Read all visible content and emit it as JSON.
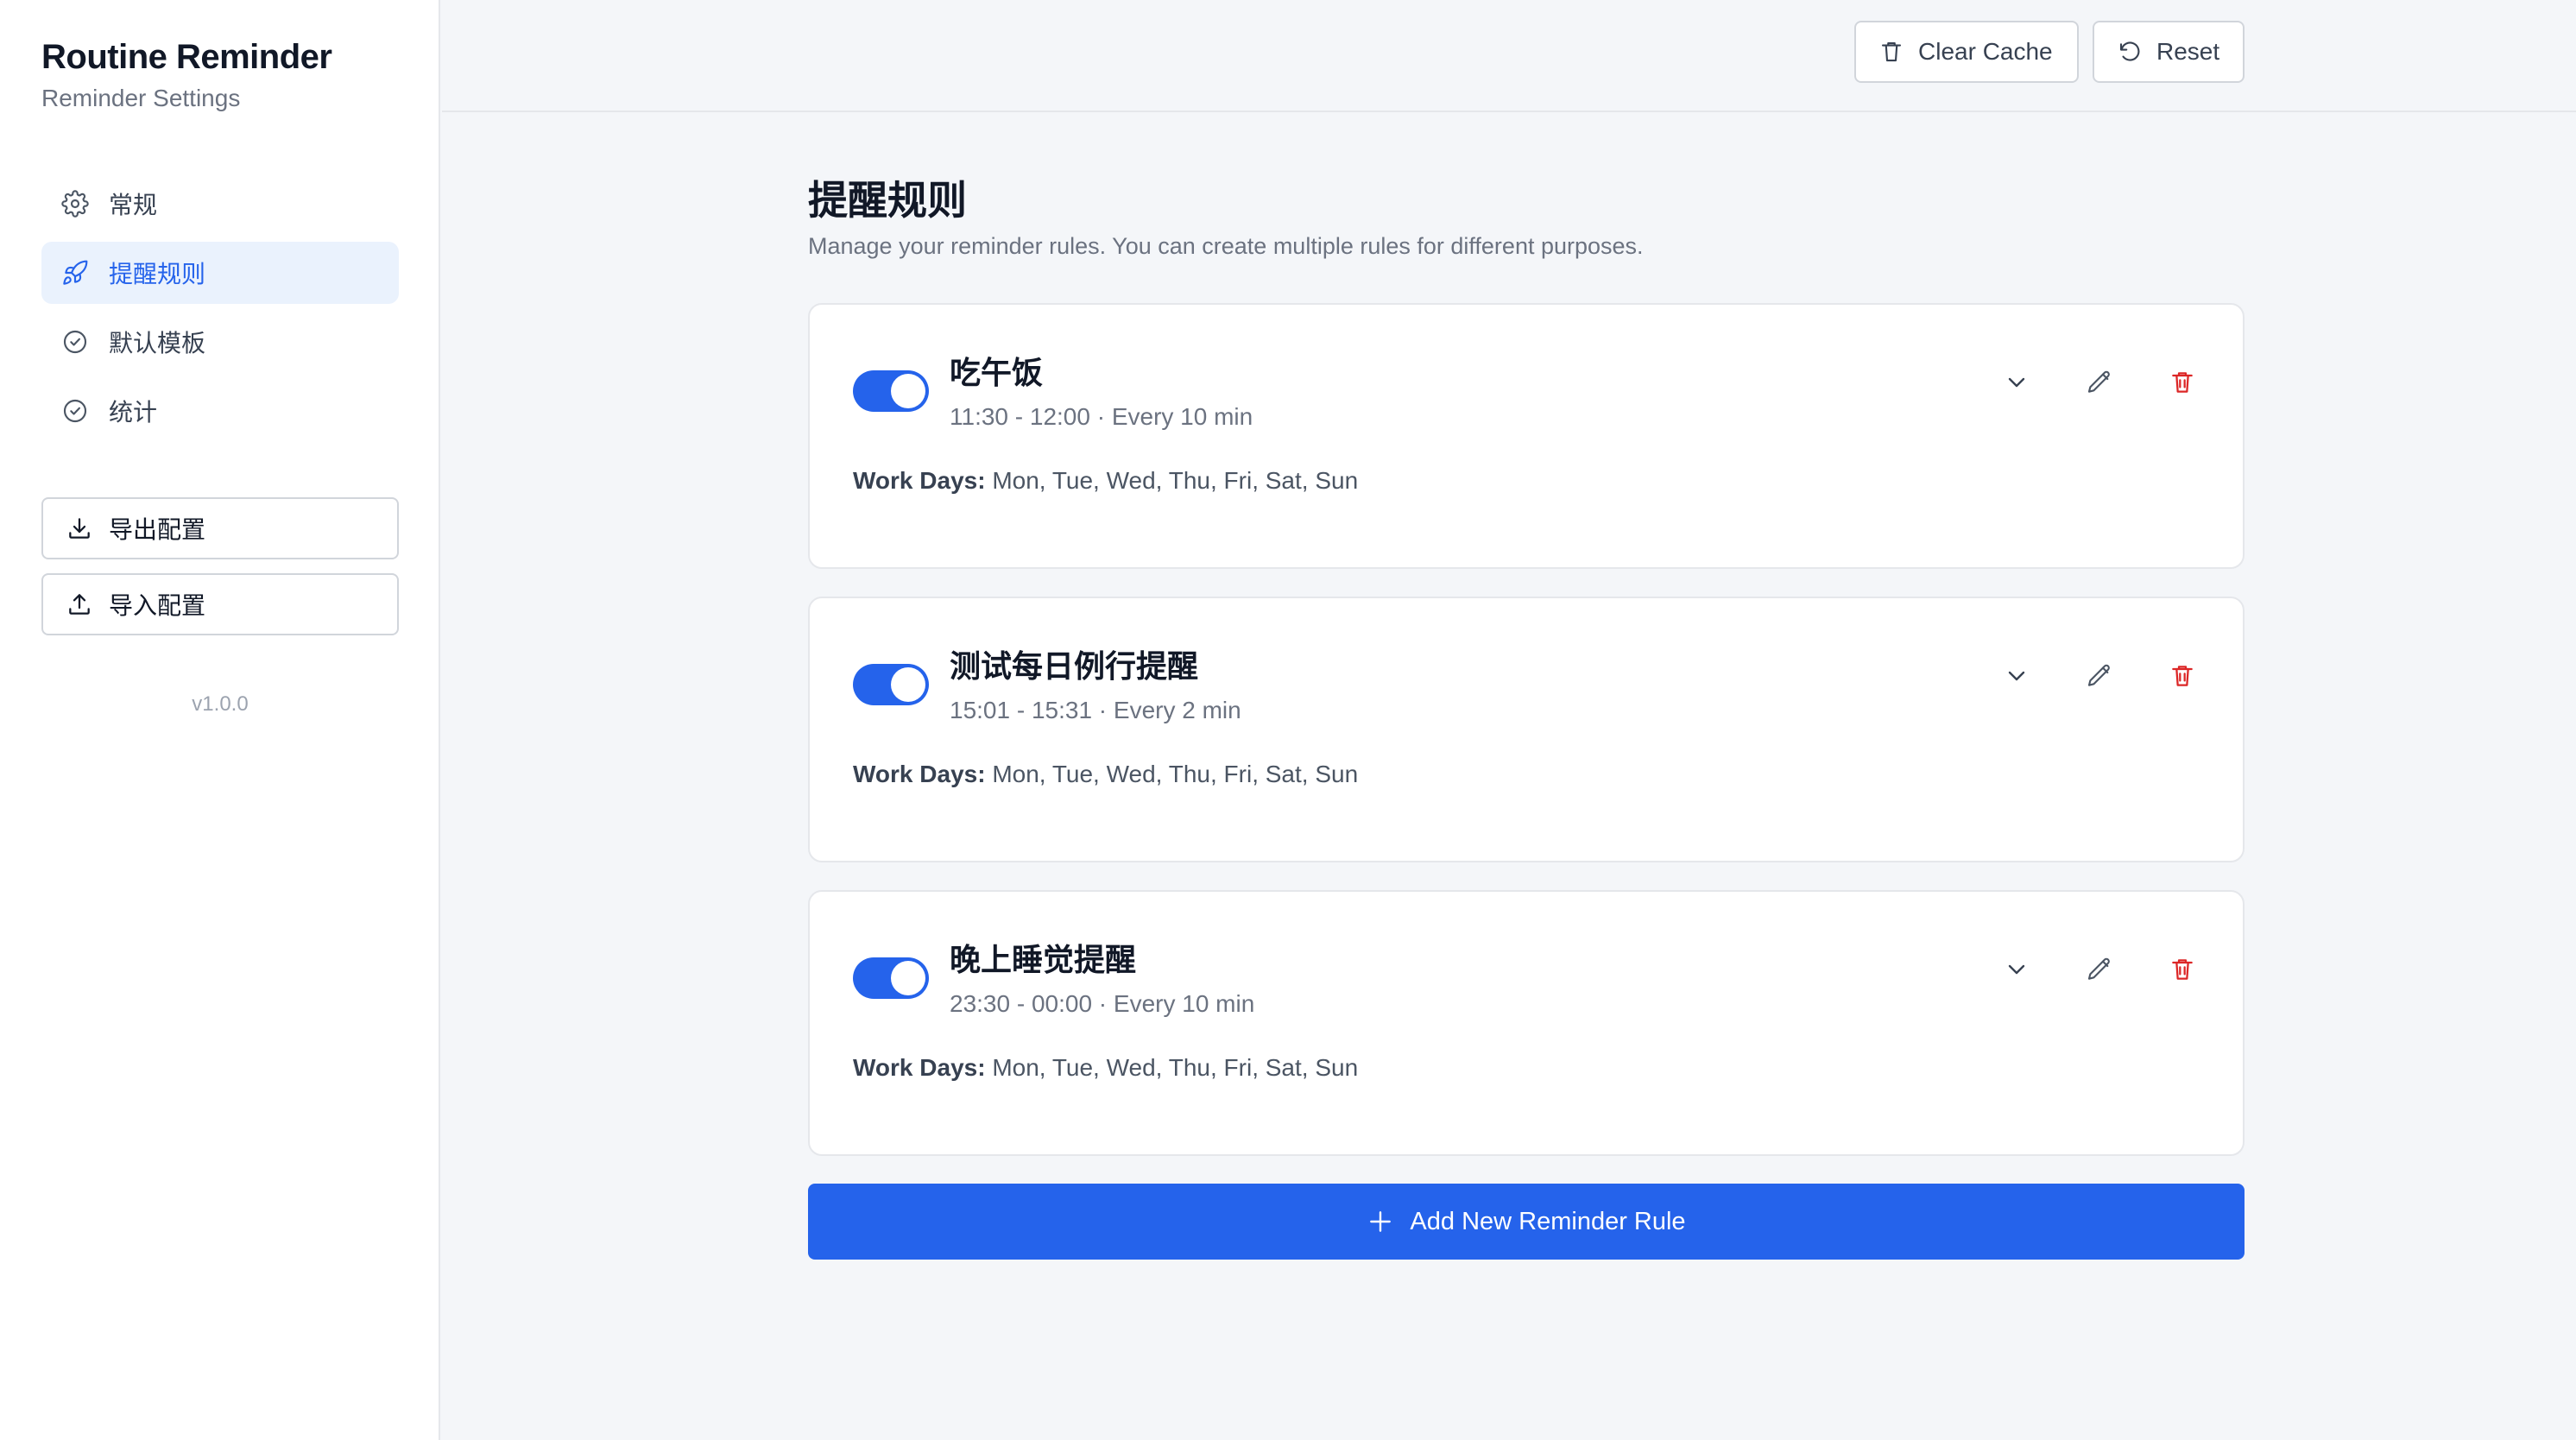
{
  "sidebar": {
    "app_title": "Routine Reminder",
    "app_subtitle": "Reminder Settings",
    "nav": [
      {
        "label": "常规",
        "icon": "gear-icon",
        "active": false
      },
      {
        "label": "提醒规则",
        "icon": "rocket-icon",
        "active": true
      },
      {
        "label": "默认模板",
        "icon": "check-circle-icon",
        "active": false
      },
      {
        "label": "统计",
        "icon": "check-circle-icon",
        "active": false
      }
    ],
    "export_label": "导出配置",
    "import_label": "导入配置",
    "version": "v1.0.0"
  },
  "toolbar": {
    "clear_cache_label": "Clear Cache",
    "reset_label": "Reset"
  },
  "main": {
    "title": "提醒规则",
    "description": "Manage your reminder rules. You can create multiple rules for different purposes.",
    "rules": [
      {
        "name": "吃午饭",
        "meta": "11:30 - 12:00 · Every 10 min",
        "days_label": "Work Days:",
        "days": "Mon, Tue, Wed, Thu, Fri, Sat, Sun",
        "enabled": true
      },
      {
        "name": "测试每日例行提醒",
        "meta": "15:01 - 15:31 · Every 2 min",
        "days_label": "Work Days:",
        "days": "Mon, Tue, Wed, Thu, Fri, Sat, Sun",
        "enabled": true
      },
      {
        "name": "晚上睡觉提醒",
        "meta": "23:30 - 00:00 · Every 10 min",
        "days_label": "Work Days:",
        "days": "Mon, Tue, Wed, Thu, Fri, Sat, Sun",
        "enabled": true
      }
    ],
    "add_label": "Add New Reminder Rule"
  },
  "colors": {
    "accent": "#2563eb",
    "active_nav_bg": "#eaf2fd",
    "danger": "#dc2626"
  }
}
